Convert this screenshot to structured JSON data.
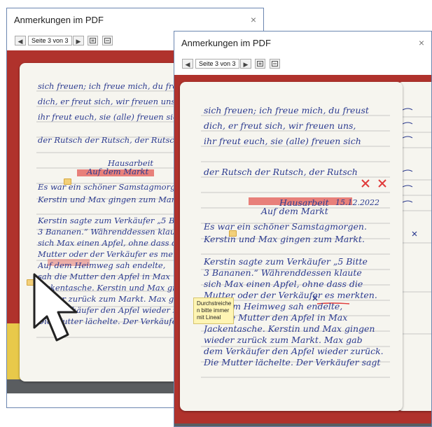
{
  "back_window": {
    "title": "Anmerkungen im PDF",
    "close_label": "×",
    "toolbar": {
      "prev_label": "◀",
      "page_label": "Seite 3 von 3",
      "next_label": "▶"
    }
  },
  "front_window": {
    "title": "Anmerkungen im PDF",
    "close_label": "×",
    "toolbar": {
      "prev_label": "◀",
      "page_label": "Seite 3 von 3",
      "next_label": "▶"
    },
    "tooltip_text": "Durchstreiche\nn bitte immer\nmit Lineal"
  },
  "handwriting": {
    "line1": "sich freuen; ich freue mich, du freust",
    "line2": "dich, er freut sich, wir freuen uns,",
    "line3": "ihr freut euch, sie (alle) freuen sich",
    "line4": "der Rutsch der Rutsch, der Rutsch",
    "heading": "Hausarbeit",
    "date": "15.12.2022",
    "subheading": "Auf dem Markt",
    "para1": "Es war ein schöner Samstagmorgen.",
    "para2": "Kerstin und Max gingen zum Markt.",
    "para3": "Kerstin sagte zum Verkäufer „5 Bitte",
    "para4": "3 Bananen.“ Währenddessen klaute",
    "para5": "sich Max einen Apfel, ohne dass die",
    "para6": "Mutter oder der Verkäufer es merkten.",
    "para7": "Auf dem Heimweg sah endelte,",
    "para8": "sah die Mutter den Apfel in Max",
    "para9": "Jackentasche. Kerstin und Max gingen",
    "para10": "wieder zurück zum Markt. Max gab",
    "para11": "dem Verkäufer den Apfel wieder zurück.",
    "para12": "Die Mutter lächelte. Der Verkäufer sagt"
  },
  "colors": {
    "ink": "#2b3a8f",
    "highlight": "#e8807a",
    "strike": "#e03b3b",
    "binder": "#b0322c",
    "tooltip_bg": "#fff5b4",
    "window_border": "#6b86b0"
  },
  "icons": {
    "cursor": "arrow-cursor-icon",
    "note": "comment-note-icon"
  }
}
